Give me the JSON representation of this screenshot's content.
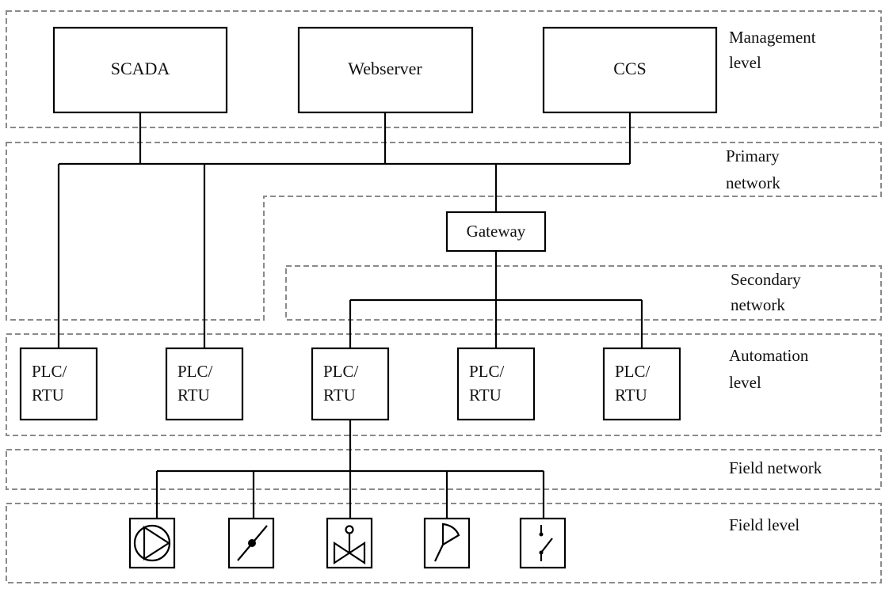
{
  "levels": {
    "management": [
      "Management",
      "level"
    ],
    "primary": [
      "Primary",
      "network"
    ],
    "secondary": [
      "Secondary",
      "network"
    ],
    "automation": [
      "Automation",
      "level"
    ],
    "field_network": "Field network",
    "field_level": "Field level"
  },
  "management_nodes": [
    "SCADA",
    "Webserver",
    "CCS"
  ],
  "gateway": "Gateway",
  "plc_nodes": [
    [
      "PLC/",
      "RTU"
    ],
    [
      "PLC/",
      "RTU"
    ],
    [
      "PLC/",
      "RTU"
    ],
    [
      "PLC/",
      "RTU"
    ],
    [
      "PLC/",
      "RTU"
    ]
  ],
  "field_devices": [
    "pump-icon",
    "damper-icon",
    "valve-icon",
    "sensor-icon",
    "switch-icon"
  ],
  "colors": {
    "zone_border": "#8a8a8a",
    "line": "#000000"
  }
}
